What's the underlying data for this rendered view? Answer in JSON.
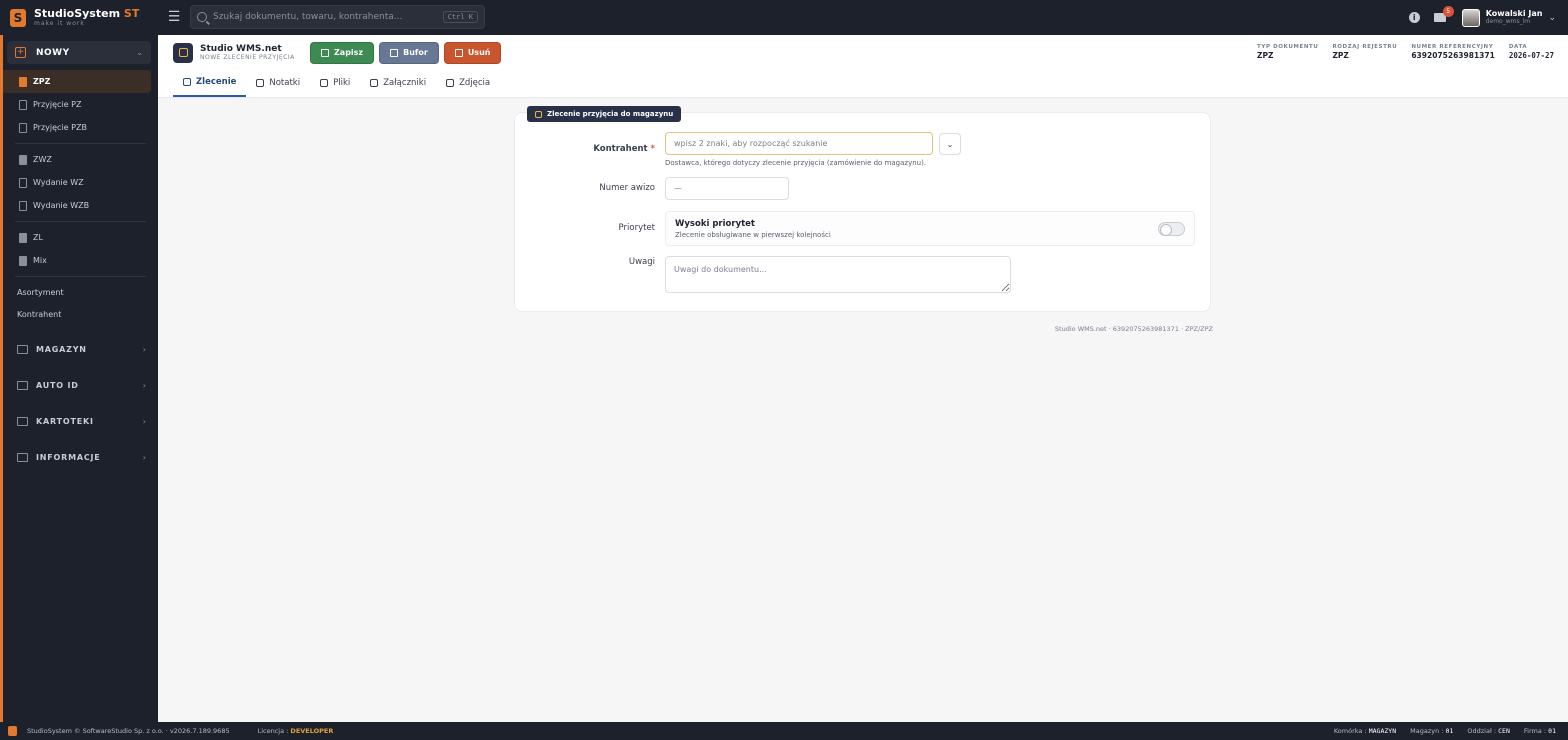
{
  "brand": {
    "name": "StudioSystem",
    "suffix": "ST",
    "tagline": "make it work"
  },
  "search": {
    "placeholder": "Szukaj dokumentu, towaru, kontrahenta...",
    "shortcut": "Ctrl K"
  },
  "topbar": {
    "mail_count": "5",
    "user_name": "Kowalski Jan",
    "user_login": "demo_wms_lm"
  },
  "sidebar": {
    "new_label": "NOWY",
    "items": [
      {
        "label": "ZPZ",
        "active": true
      },
      {
        "label": "Przyjęcie PZ"
      },
      {
        "label": "Przyjęcie PZB"
      },
      {
        "label": "ZWZ"
      },
      {
        "label": "Wydanie WZ"
      },
      {
        "label": "Wydanie WZB"
      },
      {
        "label": "ZL"
      },
      {
        "label": "Mix"
      }
    ],
    "plain": [
      "Asortyment",
      "Kontrahent"
    ],
    "groups": [
      "MAGAZYN",
      "AUTO ID",
      "KARTOTEKI",
      "INFORMACJE"
    ]
  },
  "doc": {
    "title": "Studio WMS.net",
    "subtitle": "NOWE ZLECENIE PRZYJĘCIA",
    "buttons": {
      "save": "Zapisz",
      "buffer": "Bufor",
      "delete": "Usuń"
    },
    "meta": [
      {
        "label": "TYP DOKUMENTU",
        "value": "ZPZ"
      },
      {
        "label": "RODZAJ REJESTRU",
        "value": "ZPZ"
      },
      {
        "label": "NUMER REFERENCYJNY",
        "value": "6392075263981371"
      },
      {
        "label": "DATA",
        "value": "2026-07-27"
      }
    ]
  },
  "tabs": [
    "Zlecenie",
    "Notatki",
    "Pliki",
    "Załączniki",
    "Zdjęcia"
  ],
  "form": {
    "section": "Zlecenie przyjęcia do magazynu",
    "kontrahent_label": "Kontrahent",
    "kontrahent_placeholder": "wpisz 2 znaki, aby rozpocząć szukanie",
    "kontrahent_help": "Dostawca, którego dotyczy zlecenie przyjęcia (zamówienie do magazynu).",
    "awizo_label": "Numer awizo",
    "awizo_placeholder": "—",
    "priority_label": "Priorytet",
    "priority_title": "Wysoki priorytet",
    "priority_desc": "Zlecenie obsługiwane w pierwszej kolejności",
    "notes_label": "Uwagi",
    "notes_placeholder": "Uwagi do dokumentu..."
  },
  "footer_ref": "Studio WMS.net · 6392075263981371 · ZPZ/ZPZ",
  "status": {
    "copyright": "StudioSystem © SoftwareStudio Sp. z o.o. · v2026.7.189.9685",
    "license_label": "Licencja :",
    "license_value": "DEVELOPER",
    "cell_label": "Komórka :",
    "cell_value": "MAGAZYN",
    "warehouse_label": "Magazyn :",
    "warehouse_value": "01",
    "branch_label": "Oddział :",
    "branch_value": "CEN",
    "company_label": "Firma :",
    "company_value": "01"
  }
}
